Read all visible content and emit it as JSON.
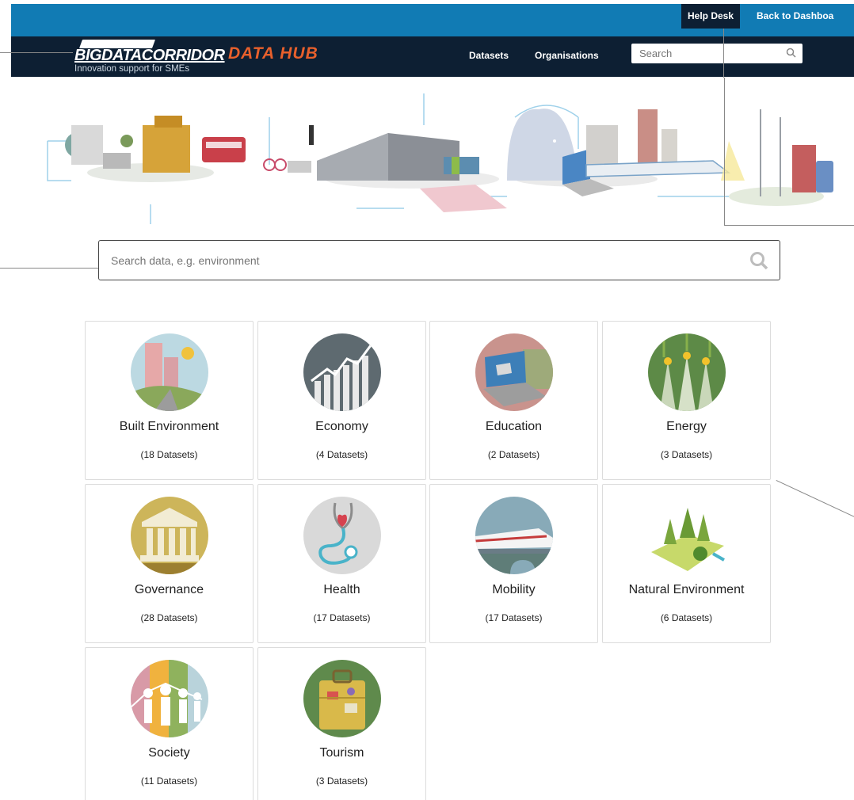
{
  "header": {
    "help_desk": "Help Desk",
    "back_to_dashboard": "Back to Dashboa",
    "logo_word": "BIGDATACORRIDOR",
    "logo_subtitle": "Innovation support for SMEs",
    "data_hub": "DATA HUB",
    "nav": {
      "datasets": "Datasets",
      "organisations": "Organisations"
    },
    "search_placeholder": "Search"
  },
  "main_search": {
    "placeholder": "Search data, e.g. environment"
  },
  "categories": [
    {
      "name": "Built Environment",
      "count": "(18 Datasets)",
      "icon": "buildings-icon"
    },
    {
      "name": "Economy",
      "count": "(4 Datasets)",
      "icon": "growth-chart-icon"
    },
    {
      "name": "Education",
      "count": "(2 Datasets)",
      "icon": "laptop-graduation-icon"
    },
    {
      "name": "Energy",
      "count": "(3 Datasets)",
      "icon": "light-bulbs-icon"
    },
    {
      "name": "Governance",
      "count": "(28 Datasets)",
      "icon": "government-building-icon"
    },
    {
      "name": "Health",
      "count": "(17 Datasets)",
      "icon": "stethoscope-icon"
    },
    {
      "name": "Mobility",
      "count": "(17 Datasets)",
      "icon": "train-icon"
    },
    {
      "name": "Natural Environment",
      "count": "(6 Datasets)",
      "icon": "trees-icon"
    },
    {
      "name": "Society",
      "count": "(11 Datasets)",
      "icon": "people-icon"
    },
    {
      "name": "Tourism",
      "count": "(3 Datasets)",
      "icon": "suitcase-icon"
    }
  ],
  "colors": {
    "topbar": "#117bb4",
    "navbar": "#0d1f33",
    "accent": "#e8602c"
  }
}
